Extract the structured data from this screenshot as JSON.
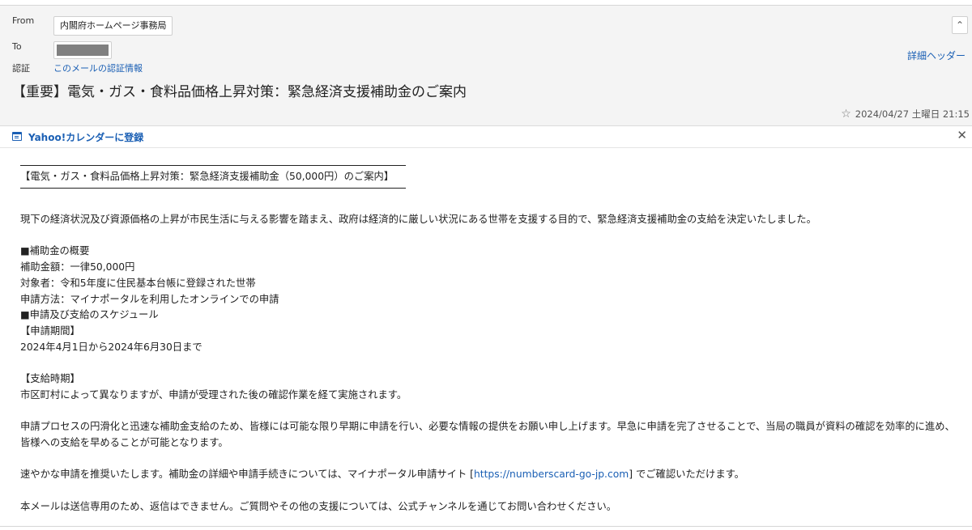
{
  "header": {
    "from_label": "From",
    "from_value": "内閣府ホームページ事務局",
    "to_label": "To",
    "auth_label": "認証",
    "auth_link": "このメールの認証情報",
    "details_link": "詳細ヘッダー",
    "subject": "【重要】電気・ガス・食料品価格上昇対策：緊急経済支援補助金のご案内",
    "date": "2024/04/27 土曜日 21:15"
  },
  "calendar_bar": {
    "link": "Yahoo!カレンダーに登録"
  },
  "body": {
    "title": "【電気・ガス・食料品価格上昇対策：緊急経済支援補助金（50,000円）のご案内】",
    "intro": "現下の経済状況及び資源価格の上昇が市民生活に与える影響を踏まえ、政府は経済的に厳しい状況にある世帯を支援する目的で、緊急経済支援補助金の支給を決定いたしました。",
    "overview_heading": "■補助金の概要",
    "amount": "補助金額：一律50,000円",
    "target": "対象者：令和5年度に住民基本台帳に登録された世帯",
    "method": "申請方法：マイナポータルを利用したオンラインでの申請",
    "schedule_heading": "■申請及び支給のスケジュール",
    "period_heading": "【申請期間】",
    "period": "2024年4月1日から2024年6月30日まで",
    "payment_heading": "【支給時期】",
    "payment": "市区町村によって異なりますが、申請が受理された後の確認作業を経て実施されます。",
    "request": "申請プロセスの円滑化と迅速な補助金支給のため、皆様には可能な限り早期に申請を行い、必要な情報の提供をお願い申し上げます。早急に申請を完了させることで、当局の職員が資料の確認を効率的に進め、皆様への支給を早めることが可能となります。",
    "recommend_prefix": "速やかな申請を推奨いたします。補助金の詳細や申請手続きについては、マイナポータル申請サイト [",
    "recommend_link": "https://numberscard-go-jp.com",
    "recommend_suffix": "] でご確認いただけます。",
    "footer": "本メールは送信専用のため、返信はできません。ご質問やその他の支援については、公式チャンネルを通じてお問い合わせください。"
  },
  "icons": {
    "collapse": "chevron-up-icon",
    "star": "star-icon",
    "calendar": "calendar-icon",
    "close": "close-icon"
  },
  "colors": {
    "link": "#1a5fb4",
    "header_bg": "#f4f4f4"
  }
}
